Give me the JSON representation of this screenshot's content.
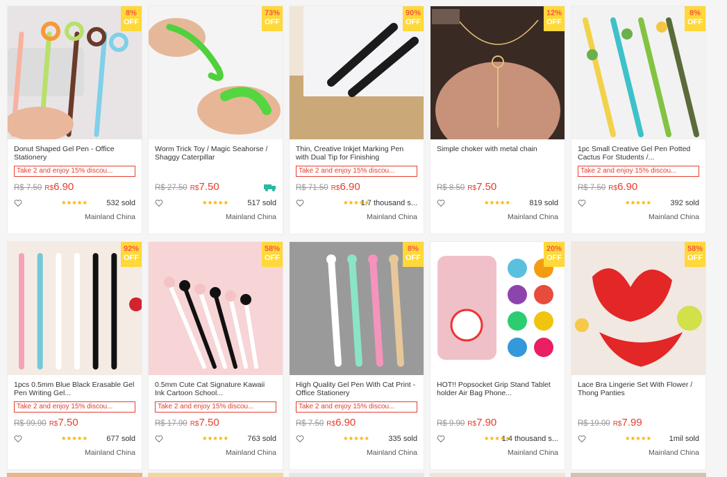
{
  "off_label": "OFF",
  "promo_text": "Take 2 and enjoy 15% discou...",
  "currency": "R$",
  "products": [
    {
      "discount": "8%",
      "title": "Donut Shaped Gel Pen - Office Stationery",
      "promo": true,
      "old_price": "R$ 7.50",
      "price": "6.90",
      "rating_stars": "★★★★★",
      "sold": "532 sold",
      "origin": "Mainland China",
      "bg": "#e8e4e6"
    },
    {
      "discount": "73%",
      "title": "Worm Trick Toy / Magic Seahorse / Shaggy Caterpillar",
      "promo": false,
      "old_price": "R$ 27.50",
      "price": "7.50",
      "rating_stars": "★★★★★",
      "sold": "517 sold",
      "origin": "Mainland China",
      "bg": "#f4f4f4",
      "truck": true
    },
    {
      "discount": "90%",
      "title": "Thin, Creative Inkjet Marking Pen with Dual Tip for Finishing",
      "promo": true,
      "old_price": "R$ 71.50",
      "price": "6.90",
      "rating_stars": "★★★★★",
      "sold": "1.7 thousand s...",
      "origin": "Mainland China",
      "bg": "#efe6d8"
    },
    {
      "discount": "12%",
      "title": "Simple choker with metal chain",
      "promo": false,
      "old_price": "R$ 8.50",
      "price": "7.50",
      "rating_stars": "★★★★★",
      "sold": "819 sold",
      "origin": "Mainland China",
      "bg": "#3a2a24"
    },
    {
      "discount": "8%",
      "title": "1pc Small Creative Gel Pen Potted Cactus For Students /...",
      "promo": true,
      "old_price": "R$ 7.50",
      "price": "6.90",
      "rating_stars": "★★★★★",
      "sold": "392 sold",
      "origin": "Mainland China",
      "bg": "#f2f2f2"
    },
    {
      "discount": "92%",
      "title": "1pcs 0.5mm Blue Black Erasable Gel Pen Writing Gel...",
      "promo": true,
      "old_price": "R$ 99.90",
      "price": "7.50",
      "rating_stars": "★★★★★",
      "sold": "677 sold",
      "origin": "Mainland China",
      "bg": "#f4ece4"
    },
    {
      "discount": "58%",
      "title": "0.5mm Cute Cat Signature Kawaii Ink Cartoon School...",
      "promo": true,
      "old_price": "R$ 17.90",
      "price": "7.50",
      "rating_stars": "★★★★★",
      "sold": "763 sold",
      "origin": "Mainland China",
      "bg": "#f7d4d6"
    },
    {
      "discount": "8%",
      "title": "High Quality Gel Pen With Cat Print - Office Stationery",
      "promo": true,
      "old_price": "R$ 7.50",
      "price": "6.90",
      "rating_stars": "★★★★★",
      "sold": "335 sold",
      "origin": "Mainland China",
      "bg": "#9a9a9a"
    },
    {
      "discount": "20%",
      "title": "HOT!! Popsocket Grip Stand Tablet holder Air Bag Phone...",
      "promo": false,
      "old_price": "R$ 9.90",
      "price": "7.90",
      "rating_stars": "★★★★★",
      "sold": "1.4 thousand s...",
      "origin": "Mainland China",
      "bg": "#ffffff"
    },
    {
      "discount": "58%",
      "title": "Lace Bra Lingerie Set With Flower / Thong Panties",
      "promo": false,
      "old_price": "R$ 19.00",
      "price": "7.99",
      "rating_stars": "★★★★★",
      "sold": "1mil sold",
      "origin": "Mainland China",
      "bg": "#f1e8e2"
    }
  ]
}
